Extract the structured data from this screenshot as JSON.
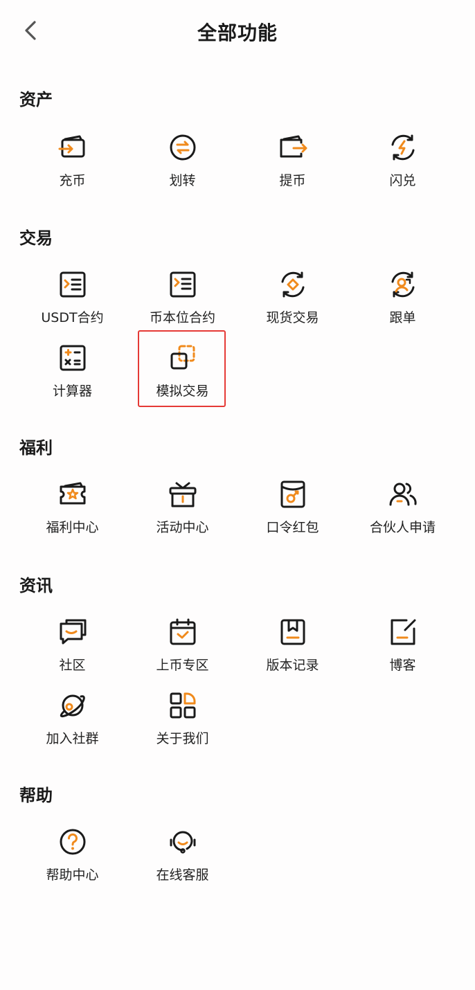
{
  "header": {
    "title": "全部功能"
  },
  "colors": {
    "accent": "#f08a1c",
    "stroke": "#1a1a1a",
    "highlight": "#e53935"
  },
  "sections": {
    "assets": {
      "title": "资产",
      "items": [
        {
          "label": "充币",
          "icon": "wallet-in-icon"
        },
        {
          "label": "划转",
          "icon": "transfer-icon"
        },
        {
          "label": "提币",
          "icon": "wallet-out-icon"
        },
        {
          "label": "闪兑",
          "icon": "flash-exchange-icon"
        }
      ]
    },
    "trade": {
      "title": "交易",
      "items": [
        {
          "label": "USDT合约",
          "icon": "contract-icon"
        },
        {
          "label": "币本位合约",
          "icon": "coin-contract-icon"
        },
        {
          "label": "现货交易",
          "icon": "spot-icon"
        },
        {
          "label": "跟单",
          "icon": "copy-trade-icon"
        },
        {
          "label": "计算器",
          "icon": "calculator-icon"
        },
        {
          "label": "模拟交易",
          "icon": "demo-trade-icon"
        }
      ]
    },
    "welfare": {
      "title": "福利",
      "items": [
        {
          "label": "福利中心",
          "icon": "ticket-icon"
        },
        {
          "label": "活动中心",
          "icon": "gift-icon"
        },
        {
          "label": "口令红包",
          "icon": "red-packet-icon"
        },
        {
          "label": "合伙人申请",
          "icon": "partner-icon"
        }
      ]
    },
    "news": {
      "title": "资讯",
      "items": [
        {
          "label": "社区",
          "icon": "community-icon"
        },
        {
          "label": "上币专区",
          "icon": "calendar-icon"
        },
        {
          "label": "版本记录",
          "icon": "bookmark-icon"
        },
        {
          "label": "博客",
          "icon": "blog-icon"
        },
        {
          "label": "加入社群",
          "icon": "planet-icon"
        },
        {
          "label": "关于我们",
          "icon": "grid-icon"
        }
      ]
    },
    "help": {
      "title": "帮助",
      "items": [
        {
          "label": "帮助中心",
          "icon": "question-icon"
        },
        {
          "label": "在线客服",
          "icon": "headset-icon"
        }
      ]
    }
  }
}
